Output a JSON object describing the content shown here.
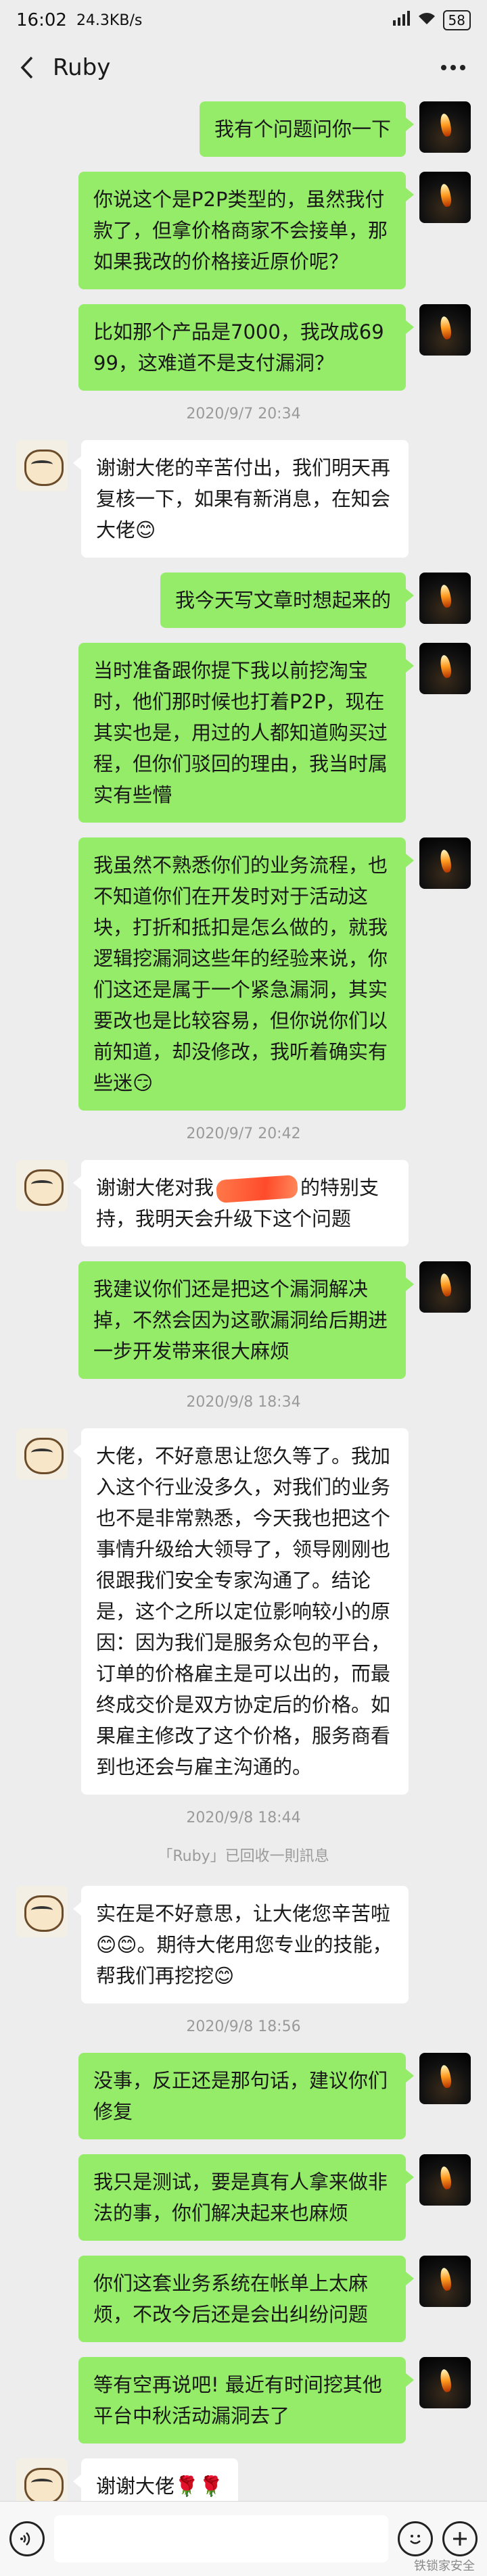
{
  "status_bar": {
    "time": "16:02",
    "speed": "24.3KB/s",
    "battery": "58"
  },
  "header": {
    "title": "Ruby"
  },
  "messages": [
    {
      "type": "msg",
      "side": "right",
      "text": "我有个问题问你一下"
    },
    {
      "type": "msg",
      "side": "right",
      "text": "你说这个是P2P类型的，虽然我付款了，但拿价格商家不会接单，那如果我改的价格接近原价呢？"
    },
    {
      "type": "msg",
      "side": "right",
      "text": "比如那个产品是7000，我改成6999，这难道不是支付漏洞？"
    },
    {
      "type": "time",
      "text": "2020/9/7 20:34"
    },
    {
      "type": "msg",
      "side": "left",
      "text": "谢谢大佬的辛苦付出，我们明天再复核一下，如果有新消息，在知会大佬😊"
    },
    {
      "type": "msg",
      "side": "right",
      "text": "我今天写文章时想起来的"
    },
    {
      "type": "msg",
      "side": "right",
      "text": "当时准备跟你提下我以前挖淘宝时，他们那时候也打着P2P，现在其实也是，用过的人都知道购买过程，但你们驳回的理由，我当时属实有些懵"
    },
    {
      "type": "msg",
      "side": "right",
      "text": "我虽然不熟悉你们的业务流程，也不知道你们在开发时对于活动这块，打折和抵扣是怎么做的，就我逻辑挖漏洞这些年的经验来说，你们这还是属于一个紧急漏洞，其实要改也是比较容易，但你说你们以前知道，却没修改，我听着确实有些迷😏"
    },
    {
      "type": "time",
      "text": "2020/9/7 20:42"
    },
    {
      "type": "msg",
      "side": "left",
      "redacted": true,
      "text_before": "谢谢大佬对我",
      "text_after": "的特别支持，我明天会升级下这个问题"
    },
    {
      "type": "msg",
      "side": "right",
      "text": "我建议你们还是把这个漏洞解决掉，不然会因为这歌漏洞给后期进一步开发带来很大麻烦"
    },
    {
      "type": "time",
      "text": "2020/9/8 18:34"
    },
    {
      "type": "msg",
      "side": "left",
      "text": "大佬，不好意思让您久等了。我加入这个行业没多久，对我们的业务也不是非常熟悉，今天我也把这个事情升级给大领导了，领导刚刚也很跟我们安全专家沟通了。结论是，这个之所以定位影响较小的原因：因为我们是服务众包的平台，订单的价格雇主是可以出的，而最终成交价是双方协定后的价格。如果雇主修改了这个价格，服务商看到也还会与雇主沟通的。"
    },
    {
      "type": "time",
      "text": "2020/9/8 18:44"
    },
    {
      "type": "system",
      "text": "「Ruby」已回收一則訊息"
    },
    {
      "type": "msg",
      "side": "left",
      "text": "实在是不好意思，让大佬您辛苦啦😊😊。期待大佬用您专业的技能，帮我们再挖挖😊"
    },
    {
      "type": "time",
      "text": "2020/9/8 18:56"
    },
    {
      "type": "msg",
      "side": "right",
      "text": "没事，反正还是那句话，建议你们修复"
    },
    {
      "type": "msg",
      "side": "right",
      "text": "我只是测试，要是真有人拿来做非法的事，你们解决起来也麻烦"
    },
    {
      "type": "msg",
      "side": "right",
      "text": "你们这套业务系统在帐单上太麻烦，不改今后还是会出纠纷问题"
    },
    {
      "type": "msg",
      "side": "right",
      "text": "等有空再说吧! 最近有时间挖其他平台中秋活动漏洞去了"
    },
    {
      "type": "msg",
      "side": "left",
      "text": "谢谢大佬🌹🌹"
    }
  ],
  "watermark": "铁锁家安全",
  "icons": {
    "back": "chevron-left-icon",
    "more": "more-dots-icon",
    "voice": "voice-icon",
    "emoji": "emoji-icon",
    "add": "plus-icon"
  },
  "colors": {
    "background": "#ededed",
    "self_bubble": "#95ec69",
    "other_bubble": "#ffffff"
  }
}
